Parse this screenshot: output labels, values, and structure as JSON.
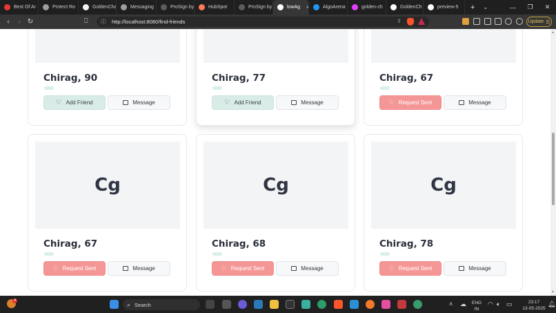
{
  "browser": {
    "tabs": [
      {
        "label": "Best Of Ar",
        "favicon_color": "#e53935"
      },
      {
        "label": "Protect Ro",
        "favicon_color": "#9e9e9e"
      },
      {
        "label": "GoldenCha",
        "favicon_color": "#f5f5f5"
      },
      {
        "label": "Messaging",
        "favicon_color": "#9e9e9e"
      },
      {
        "label": "ProSign by",
        "favicon_color": "#5c5c5c"
      },
      {
        "label": "HubSpot",
        "favicon_color": "#ff7a59"
      },
      {
        "label": "ProSign by",
        "favicon_color": "#5c5c5c"
      },
      {
        "label": "lowAg",
        "favicon_color": "#ffffff",
        "active": true
      },
      {
        "label": "AlgoArena",
        "favicon_color": "#2196f3"
      },
      {
        "label": "golden-ch",
        "favicon_color": "#e040fb"
      },
      {
        "label": "GoldenCh",
        "favicon_color": "#ffffff"
      },
      {
        "label": "preview-5",
        "favicon_color": "#ffffff"
      }
    ],
    "new_tab": "+",
    "tab_close": "×",
    "url": "http://localhost:8080/find-friends",
    "update_label": "Update",
    "window_controls": {
      "minimize": "—",
      "maximize": "❐",
      "close": "✕"
    }
  },
  "cards": [
    {
      "name": "Chirag, 90",
      "initials": "",
      "action": "Add Friend",
      "action_state": "add",
      "message_label": "Message"
    },
    {
      "name": "Chirag, 77",
      "initials": "",
      "action": "Add Friend",
      "action_state": "add",
      "message_label": "Message"
    },
    {
      "name": "Chirag, 67",
      "initials": "",
      "action": "Request Sent",
      "action_state": "sent",
      "message_label": "Message"
    },
    {
      "name": "Chirag, 67",
      "initials": "Cg",
      "action": "Request Sent",
      "action_state": "sent",
      "message_label": "Message"
    },
    {
      "name": "Chirag, 68",
      "initials": "Cg",
      "action": "Request Sent",
      "action_state": "sent",
      "message_label": "Message"
    },
    {
      "name": "Chirag, 78",
      "initials": "Cg",
      "action": "Request Sent",
      "action_state": "sent",
      "message_label": "Message"
    }
  ],
  "colors": {
    "add_bg": "#d9ece7",
    "sent_bg": "#f59696",
    "chip": "#d9efe9"
  },
  "taskbar": {
    "search_label": "Search",
    "notification_count": "4",
    "language_line1": "ENG",
    "language_line2": "IN",
    "time": "23:17",
    "date": "13-05-2025"
  }
}
